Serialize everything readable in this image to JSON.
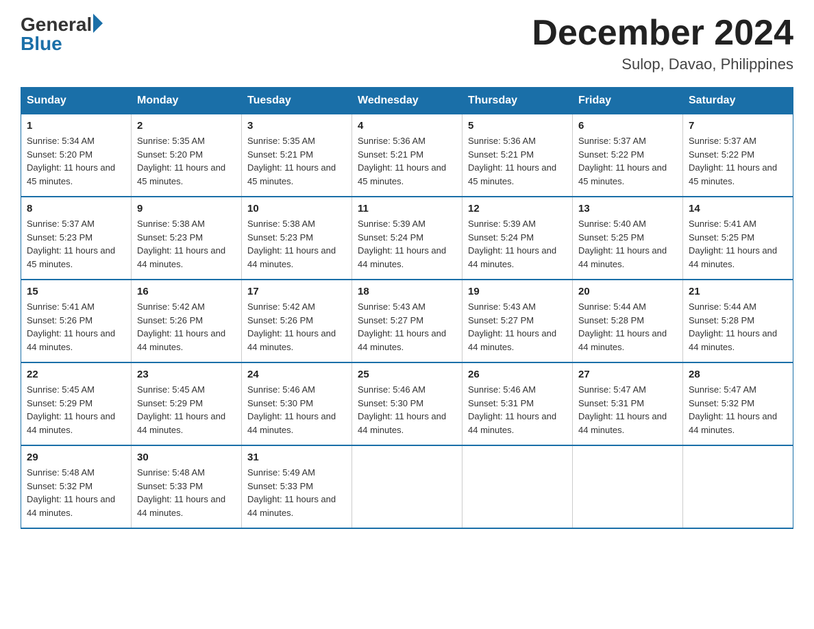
{
  "header": {
    "logo_general": "General",
    "logo_blue": "Blue",
    "main_title": "December 2024",
    "subtitle": "Sulop, Davao, Philippines"
  },
  "calendar": {
    "days_of_week": [
      "Sunday",
      "Monday",
      "Tuesday",
      "Wednesday",
      "Thursday",
      "Friday",
      "Saturday"
    ],
    "weeks": [
      [
        {
          "day": "1",
          "sunrise": "5:34 AM",
          "sunset": "5:20 PM",
          "daylight": "11 hours and 45 minutes."
        },
        {
          "day": "2",
          "sunrise": "5:35 AM",
          "sunset": "5:20 PM",
          "daylight": "11 hours and 45 minutes."
        },
        {
          "day": "3",
          "sunrise": "5:35 AM",
          "sunset": "5:21 PM",
          "daylight": "11 hours and 45 minutes."
        },
        {
          "day": "4",
          "sunrise": "5:36 AM",
          "sunset": "5:21 PM",
          "daylight": "11 hours and 45 minutes."
        },
        {
          "day": "5",
          "sunrise": "5:36 AM",
          "sunset": "5:21 PM",
          "daylight": "11 hours and 45 minutes."
        },
        {
          "day": "6",
          "sunrise": "5:37 AM",
          "sunset": "5:22 PM",
          "daylight": "11 hours and 45 minutes."
        },
        {
          "day": "7",
          "sunrise": "5:37 AM",
          "sunset": "5:22 PM",
          "daylight": "11 hours and 45 minutes."
        }
      ],
      [
        {
          "day": "8",
          "sunrise": "5:37 AM",
          "sunset": "5:23 PM",
          "daylight": "11 hours and 45 minutes."
        },
        {
          "day": "9",
          "sunrise": "5:38 AM",
          "sunset": "5:23 PM",
          "daylight": "11 hours and 44 minutes."
        },
        {
          "day": "10",
          "sunrise": "5:38 AM",
          "sunset": "5:23 PM",
          "daylight": "11 hours and 44 minutes."
        },
        {
          "day": "11",
          "sunrise": "5:39 AM",
          "sunset": "5:24 PM",
          "daylight": "11 hours and 44 minutes."
        },
        {
          "day": "12",
          "sunrise": "5:39 AM",
          "sunset": "5:24 PM",
          "daylight": "11 hours and 44 minutes."
        },
        {
          "day": "13",
          "sunrise": "5:40 AM",
          "sunset": "5:25 PM",
          "daylight": "11 hours and 44 minutes."
        },
        {
          "day": "14",
          "sunrise": "5:41 AM",
          "sunset": "5:25 PM",
          "daylight": "11 hours and 44 minutes."
        }
      ],
      [
        {
          "day": "15",
          "sunrise": "5:41 AM",
          "sunset": "5:26 PM",
          "daylight": "11 hours and 44 minutes."
        },
        {
          "day": "16",
          "sunrise": "5:42 AM",
          "sunset": "5:26 PM",
          "daylight": "11 hours and 44 minutes."
        },
        {
          "day": "17",
          "sunrise": "5:42 AM",
          "sunset": "5:26 PM",
          "daylight": "11 hours and 44 minutes."
        },
        {
          "day": "18",
          "sunrise": "5:43 AM",
          "sunset": "5:27 PM",
          "daylight": "11 hours and 44 minutes."
        },
        {
          "day": "19",
          "sunrise": "5:43 AM",
          "sunset": "5:27 PM",
          "daylight": "11 hours and 44 minutes."
        },
        {
          "day": "20",
          "sunrise": "5:44 AM",
          "sunset": "5:28 PM",
          "daylight": "11 hours and 44 minutes."
        },
        {
          "day": "21",
          "sunrise": "5:44 AM",
          "sunset": "5:28 PM",
          "daylight": "11 hours and 44 minutes."
        }
      ],
      [
        {
          "day": "22",
          "sunrise": "5:45 AM",
          "sunset": "5:29 PM",
          "daylight": "11 hours and 44 minutes."
        },
        {
          "day": "23",
          "sunrise": "5:45 AM",
          "sunset": "5:29 PM",
          "daylight": "11 hours and 44 minutes."
        },
        {
          "day": "24",
          "sunrise": "5:46 AM",
          "sunset": "5:30 PM",
          "daylight": "11 hours and 44 minutes."
        },
        {
          "day": "25",
          "sunrise": "5:46 AM",
          "sunset": "5:30 PM",
          "daylight": "11 hours and 44 minutes."
        },
        {
          "day": "26",
          "sunrise": "5:46 AM",
          "sunset": "5:31 PM",
          "daylight": "11 hours and 44 minutes."
        },
        {
          "day": "27",
          "sunrise": "5:47 AM",
          "sunset": "5:31 PM",
          "daylight": "11 hours and 44 minutes."
        },
        {
          "day": "28",
          "sunrise": "5:47 AM",
          "sunset": "5:32 PM",
          "daylight": "11 hours and 44 minutes."
        }
      ],
      [
        {
          "day": "29",
          "sunrise": "5:48 AM",
          "sunset": "5:32 PM",
          "daylight": "11 hours and 44 minutes."
        },
        {
          "day": "30",
          "sunrise": "5:48 AM",
          "sunset": "5:33 PM",
          "daylight": "11 hours and 44 minutes."
        },
        {
          "day": "31",
          "sunrise": "5:49 AM",
          "sunset": "5:33 PM",
          "daylight": "11 hours and 44 minutes."
        },
        null,
        null,
        null,
        null
      ]
    ]
  }
}
